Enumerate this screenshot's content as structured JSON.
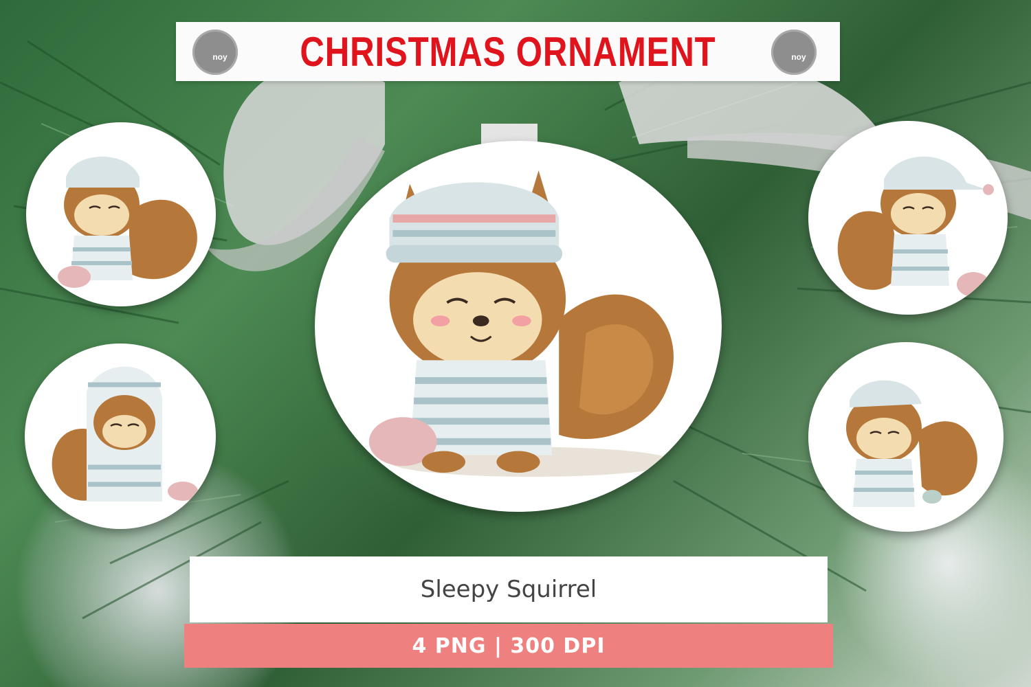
{
  "banner": {
    "title": "CHRISTMAS ORNAMENT",
    "logo_text": "noy"
  },
  "subtitle": "Sleepy Squirrel",
  "info": "4 PNG | 300 DPI",
  "colors": {
    "title_red": "#e0141c",
    "info_bar": "#ee8080",
    "banner_bg": "#fbfbfb",
    "logo_gray": "#8e8e8e"
  },
  "ornaments": [
    {
      "id": "main",
      "subject": "squirrel-in-striped-pajamas-and-nightcap"
    },
    {
      "id": "top-left",
      "subject": "squirrel-in-striped-pajamas"
    },
    {
      "id": "bottom-left",
      "subject": "squirrel-in-hooded-pajamas"
    },
    {
      "id": "top-right",
      "subject": "squirrel-in-nightcap"
    },
    {
      "id": "bottom-right",
      "subject": "squirrel-in-pajamas"
    }
  ]
}
